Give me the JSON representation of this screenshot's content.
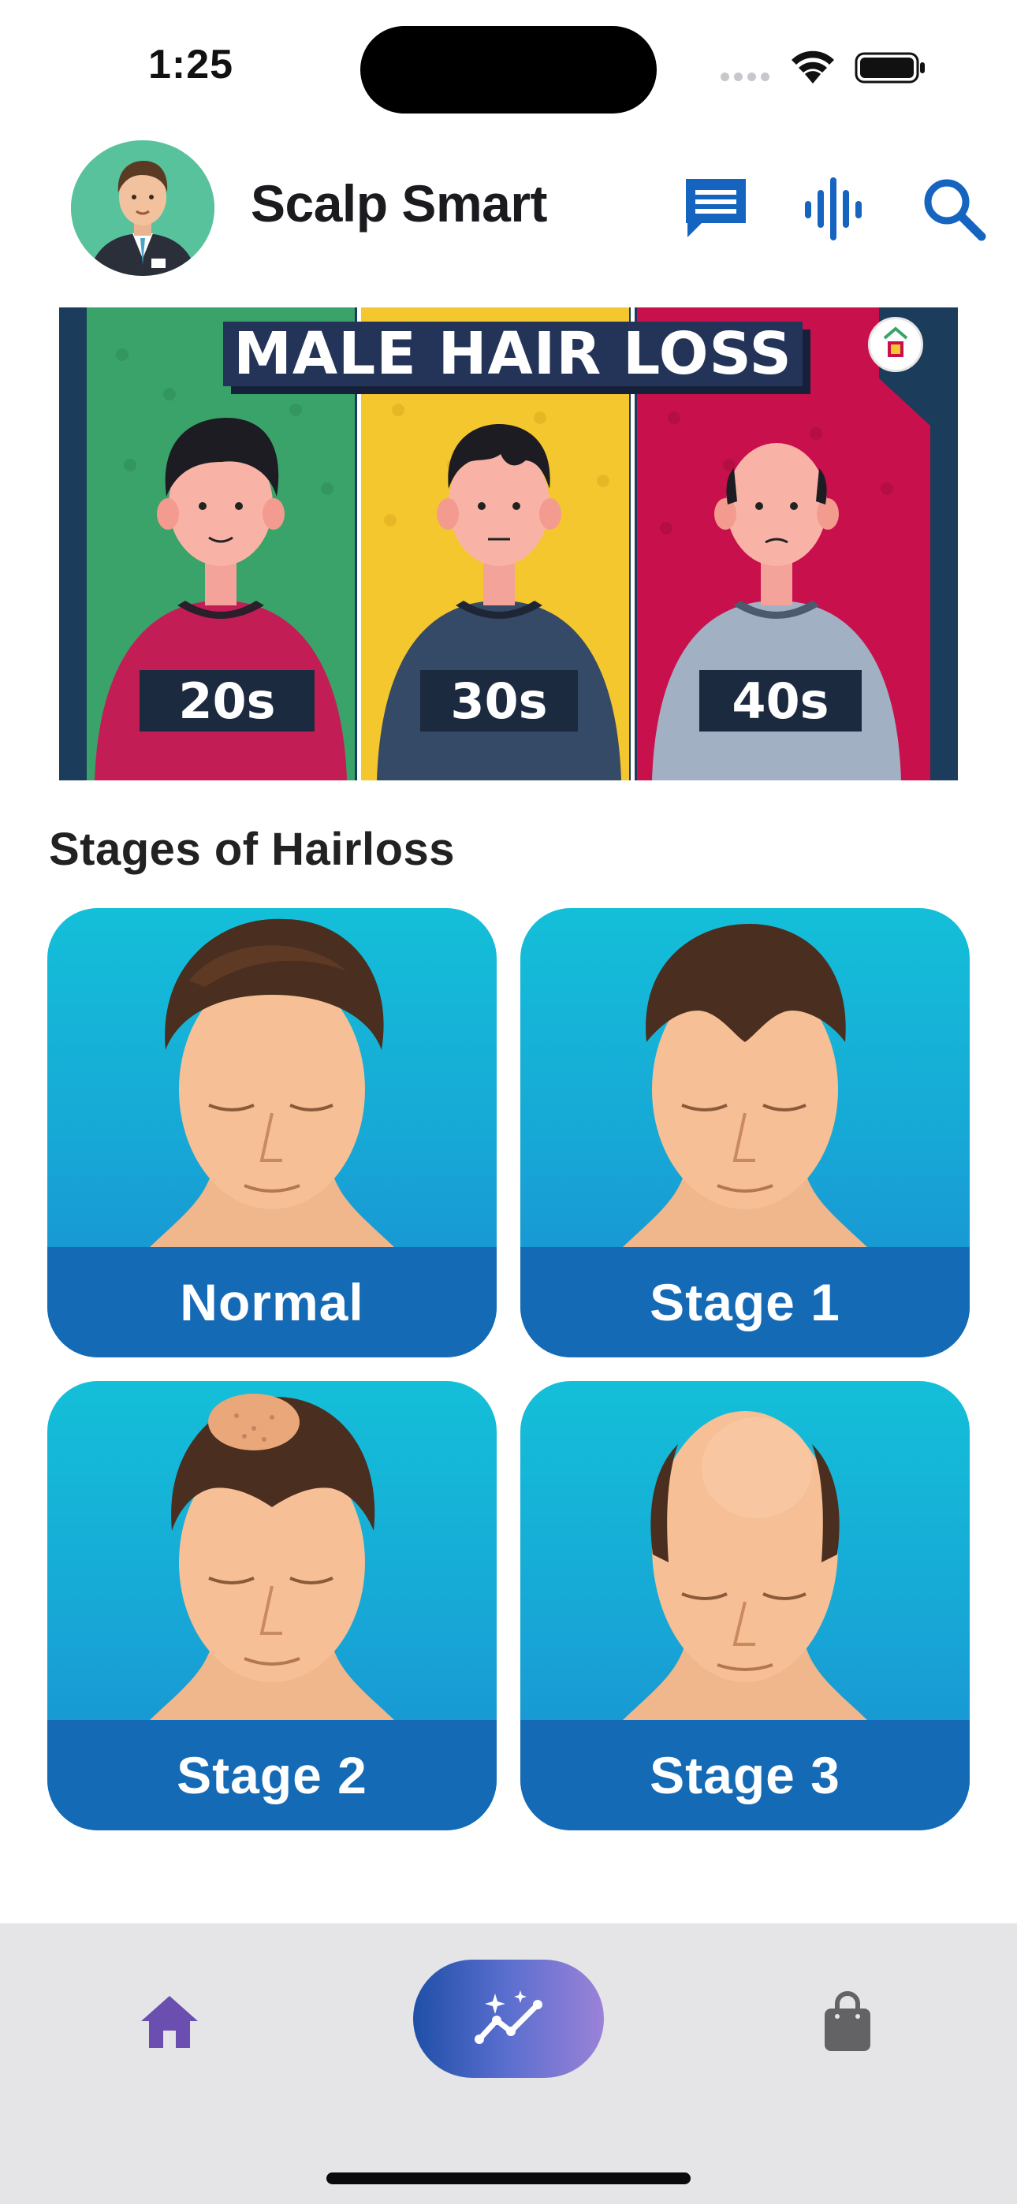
{
  "status_bar": {
    "time": "1:25"
  },
  "header": {
    "title": "Scalp Smart",
    "icons": [
      "chat-icon",
      "voice-wave-icon",
      "search-icon"
    ],
    "accent_color": "#1565c0"
  },
  "banner": {
    "title": "MALE HAIR LOSS",
    "ages": [
      "20s",
      "30s",
      "40s"
    ],
    "panel_colors": [
      "#3aa36a",
      "#f5c72f",
      "#c8104c"
    ]
  },
  "section": {
    "title": "Stages of Hairloss"
  },
  "stages": [
    {
      "label": "Normal"
    },
    {
      "label": "Stage 1"
    },
    {
      "label": "Stage 2"
    },
    {
      "label": "Stage 3"
    }
  ],
  "tab_bar": {
    "items": [
      "home-icon",
      "analytics-sparkle-icon",
      "shopping-bag-icon"
    ],
    "active": "home-icon",
    "active_color": "#6a4fb0"
  }
}
